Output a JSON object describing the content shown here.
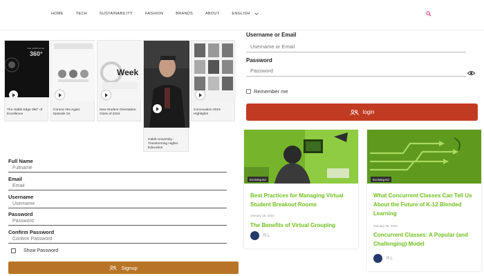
{
  "nav": {
    "items": [
      "HOME",
      "TECH",
      "SUSTAINABILITY",
      "FASHION",
      "BRANDS",
      "ABOUT",
      "ENGLISH"
    ],
    "language_chevron": "chevron-down-icon",
    "search_icon": "search-icon",
    "accent": "#e53b8b"
  },
  "videos": [
    {
      "caption": "The Habib Edge 360° of Excellence"
    },
    {
      "caption": "Corona Yes Again: Episode 19"
    },
    {
      "caption": "New Student Orientation: Class of 2024"
    },
    {
      "caption": "Habib University - Transforming Higher Education"
    },
    {
      "caption": "Convocation 2019 Highlights"
    }
  ],
  "login": {
    "username_label": "Username or Email",
    "username_placeholder": "Username or Email",
    "password_label": "Password",
    "password_placeholder": "Password",
    "remember_label": "Remember me",
    "button_label": "login",
    "button_color": "#c13b22"
  },
  "articles": [
    {
      "badge": "Evolving Ed",
      "title": "Best Practices for Managing Virtual Student Breakout Rooms",
      "date": "January 28, 2022",
      "related_title": "The Benefits of Virtual Grouping",
      "author": "R.L"
    },
    {
      "badge": "Evolving Ed",
      "title": "What Concurrent Classes Can Tell Us About the Future of K-12 Blended Learning",
      "date": "January 28, 2022",
      "related_title": "Concurrent Classes: A Popular (and Challenging) Model",
      "author": "R.L"
    }
  ],
  "signup": {
    "fields": [
      {
        "label": "Full Name",
        "placeholder": "Fullname"
      },
      {
        "label": "Email",
        "placeholder": "Email"
      },
      {
        "label": "Username",
        "placeholder": "Username"
      },
      {
        "label": "Password",
        "placeholder": "Password"
      },
      {
        "label": "Confirm Password",
        "placeholder": "Confirm Password"
      }
    ],
    "show_password_label": "Show Password",
    "button_label": "Signup",
    "button_color": "#b87426"
  }
}
